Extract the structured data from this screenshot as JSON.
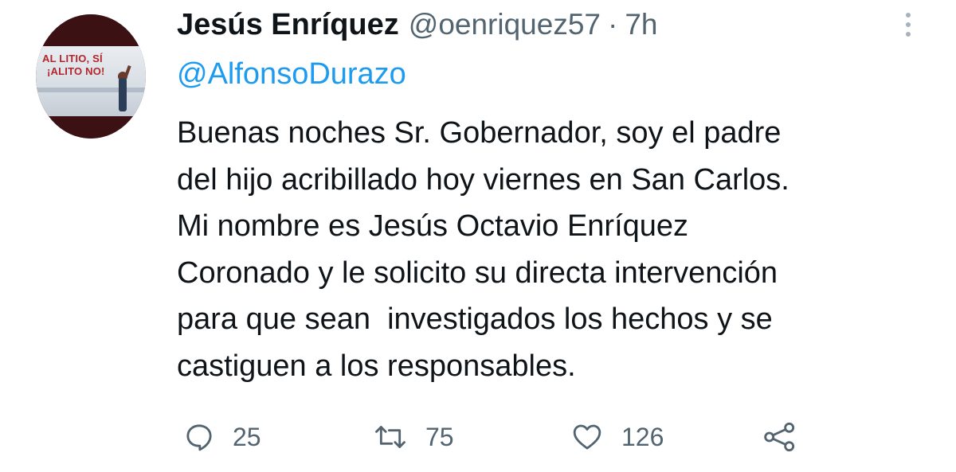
{
  "tweet": {
    "author": {
      "display_name": "Jesús Enríquez",
      "handle": "@oenriquez57",
      "avatar_text_line1": "AL LITIO, SÍ",
      "avatar_text_line2": "¡ALITO NO!"
    },
    "separator": "·",
    "time": "7h",
    "mention": "@AlfonsoDurazo",
    "body_lines": [
      "Buenas noches Sr. Gobernador, soy el padre",
      "del hijo acribillado hoy viernes en San Carlos.",
      "Mi nombre es Jesús Octavio Enríquez",
      "Coronado y le solicito su directa intervención",
      "para que sean  investigados los hechos y se",
      "castiguen a los responsables."
    ],
    "actions": {
      "reply_count": "25",
      "retweet_count": "75",
      "like_count": "126"
    },
    "icons": {
      "reply": "reply-icon",
      "retweet": "retweet-icon",
      "like": "heart-icon",
      "share": "share-icon",
      "more": "more-vertical-icon"
    },
    "colors": {
      "text": "#0f1419",
      "secondary": "#536471",
      "link": "#1d9bf0"
    }
  }
}
